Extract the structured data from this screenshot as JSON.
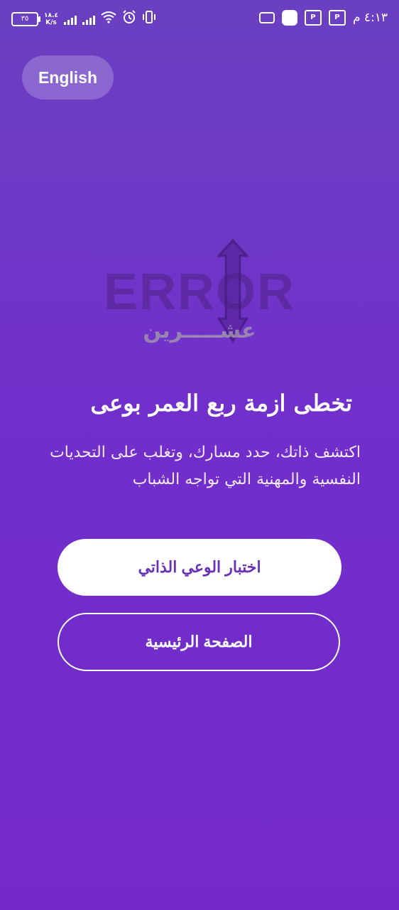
{
  "status_bar": {
    "battery": "٣٥",
    "net_speed_value": "١٨.٤",
    "net_speed_unit": "K/s",
    "time": "٤:١٣ م"
  },
  "language_button": {
    "label": "English"
  },
  "logo": {
    "line1": "ERROR",
    "line2": "عشـــــرين"
  },
  "hero": {
    "headline": "تخطى ازمة ربع العمر بوعى",
    "description": "اكتشف ذاتك، حدد مسارك، وتغلب على التحديات النفسية والمهنية التي تواجه الشباب"
  },
  "buttons": {
    "primary": "اختبار الوعي الذاتي",
    "secondary": "الصفحة الرئيسية"
  },
  "colors": {
    "background_top": "#6a40c1",
    "background_bottom": "#7329c9",
    "button_text": "#6a31b8"
  }
}
